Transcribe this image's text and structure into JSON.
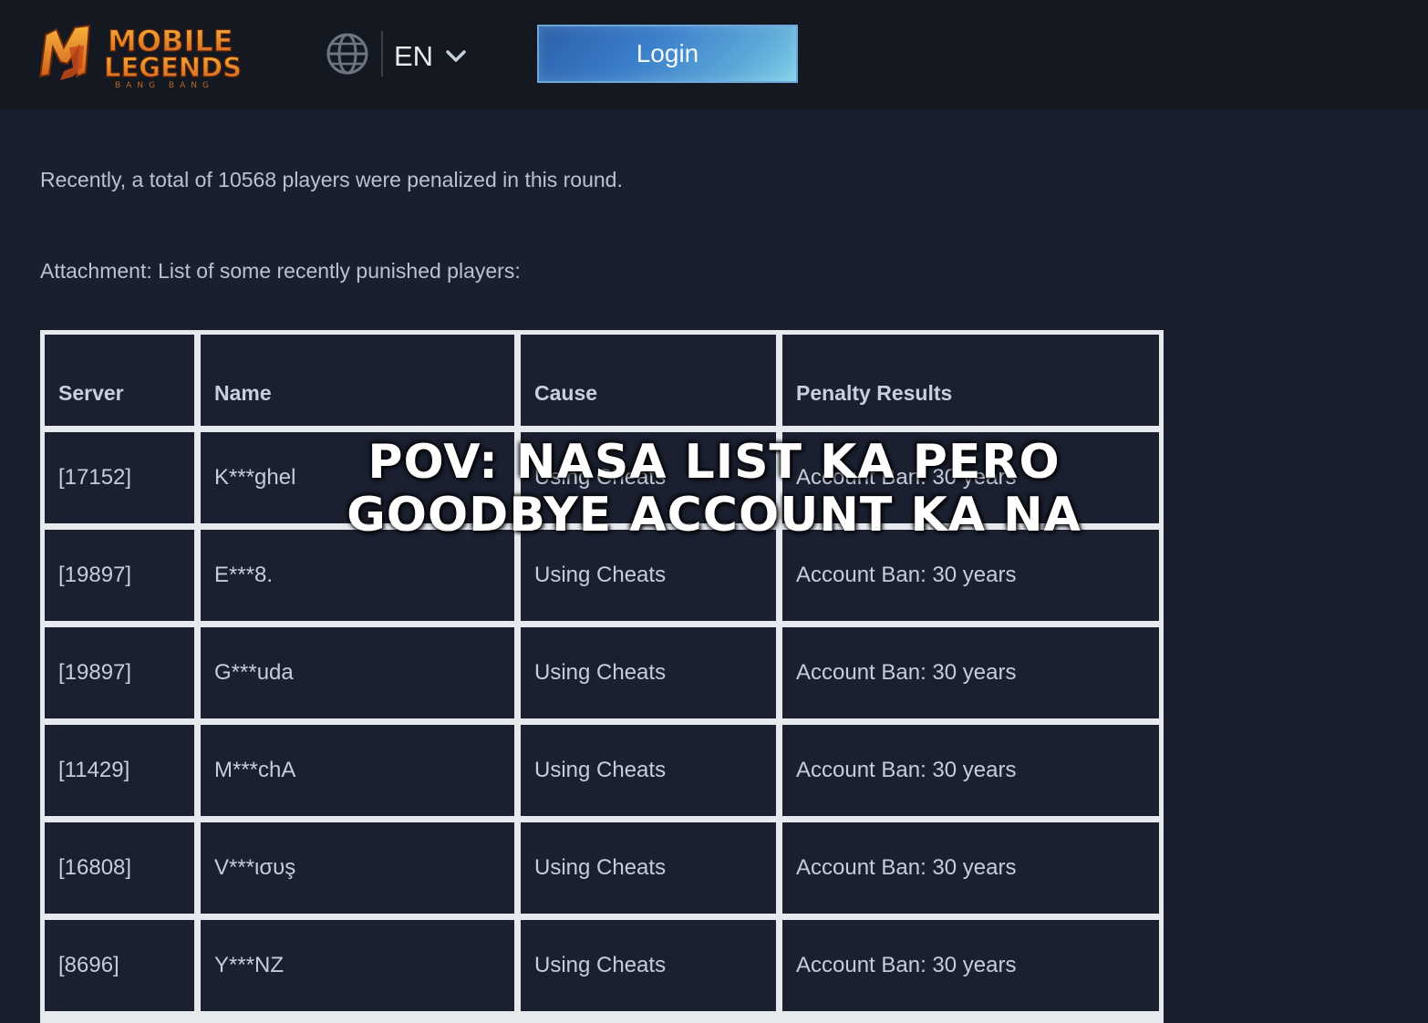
{
  "header": {
    "logo_text": "MOBILE LEGENDS",
    "logo_sub": "BANG BANG",
    "language": "EN",
    "login_label": "Login"
  },
  "article": {
    "summary": "Recently, a total of 10568 players were penalized in this round.",
    "attachment_label": "Attachment: List of some recently punished players:"
  },
  "table": {
    "headers": [
      "Server",
      "Name",
      "Cause",
      "Penalty Results"
    ],
    "rows": [
      [
        "[17152]",
        "K***ghel",
        "Using Cheats",
        "Account Ban: 30 years"
      ],
      [
        "[19897]",
        "E***8.",
        "Using Cheats",
        "Account Ban: 30 years"
      ],
      [
        "[19897]",
        "G***uda",
        "Using Cheats",
        "Account Ban: 30 years"
      ],
      [
        "[11429]",
        "M***chA",
        "Using Cheats",
        "Account Ban: 30 years"
      ],
      [
        "[16808]",
        "V***ισυş",
        "Using Cheats",
        "Account Ban: 30 years"
      ],
      [
        "[8696]",
        "Y***NZ",
        "Using Cheats",
        "Account Ban: 30 years"
      ]
    ]
  },
  "overlay": {
    "line1": "POV: NASA LIST KA PERO",
    "line2": "GOODBYE ACCOUNT KA NA"
  },
  "colors": {
    "background": "#1a1f2e",
    "topbar": "#141821",
    "table_border": "#e6e9ee",
    "logo_orange": "#e88a2a"
  },
  "icons": {
    "globe": "globe-icon",
    "chevron": "chevron-down-icon"
  }
}
